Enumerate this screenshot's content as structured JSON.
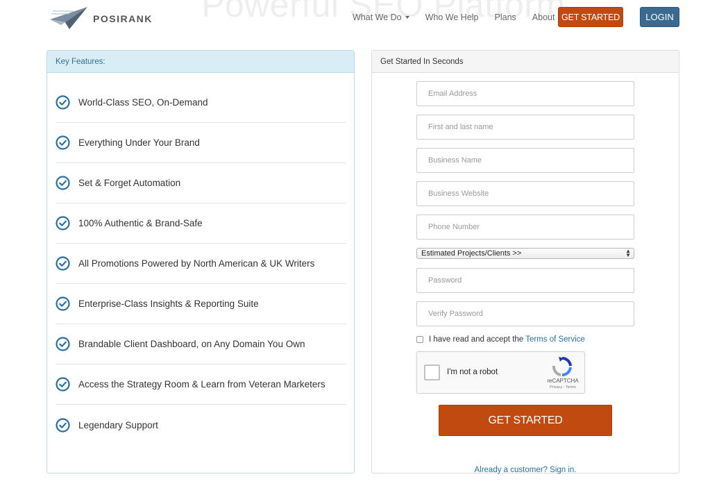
{
  "hero": {
    "background_title": "Powerful SEO Platform"
  },
  "brand": {
    "name": "POSIRANK",
    "logo_icon": "paper-plane-icon"
  },
  "nav": {
    "items": [
      {
        "label": "What We Do",
        "has_dropdown": true
      },
      {
        "label": "Who We Help",
        "has_dropdown": false
      },
      {
        "label": "Plans",
        "has_dropdown": false
      },
      {
        "label": "About",
        "has_dropdown": false
      }
    ],
    "get_started_label": "GET STARTED",
    "login_label": "LOGIN"
  },
  "features_panel": {
    "title": "Key Features:",
    "items": [
      "World-Class SEO, On-Demand",
      "Everything Under Your Brand",
      "Set & Forget Automation",
      "100% Authentic & Brand-Safe",
      "All Promotions Powered by North American & UK Writers",
      "Enterprise-Class Insights & Reporting Suite",
      "Brandable Client Dashboard, on Any Domain You Own",
      "Access the Strategy Room & Learn from Veteran Marketers",
      "Legendary Support"
    ]
  },
  "signup_panel": {
    "title": "Get Started In Seconds",
    "fields": {
      "email": {
        "value": "",
        "placeholder": "Email Address"
      },
      "name": {
        "value": "",
        "placeholder": "First and last name"
      },
      "business_name": {
        "value": "",
        "placeholder": "Business Name"
      },
      "business_website": {
        "value": "",
        "placeholder": "Business Website"
      },
      "phone": {
        "value": "",
        "placeholder": "Phone Number"
      },
      "password": {
        "value": "",
        "placeholder": "Password"
      },
      "verify_password": {
        "value": "",
        "placeholder": "Verify Password"
      }
    },
    "projects_select": {
      "selected": "Estimated Projects/Clients >>"
    },
    "tos": {
      "text": "I have read and accept the",
      "link": "Terms of Service",
      "checked": false
    },
    "captcha": {
      "label": "I'm not a robot",
      "brand": "reCAPTCHA",
      "terms": "Privacy - Terms"
    },
    "submit_label": "GET STARTED",
    "signin_text": "Already a customer? Sign in."
  },
  "colors": {
    "accent_orange": "#c04a0f",
    "login_blue": "#3a6a90",
    "link_blue": "#2a6fa0",
    "check_blue": "#2a6fa0",
    "features_header_bg": "#d9edf7"
  }
}
